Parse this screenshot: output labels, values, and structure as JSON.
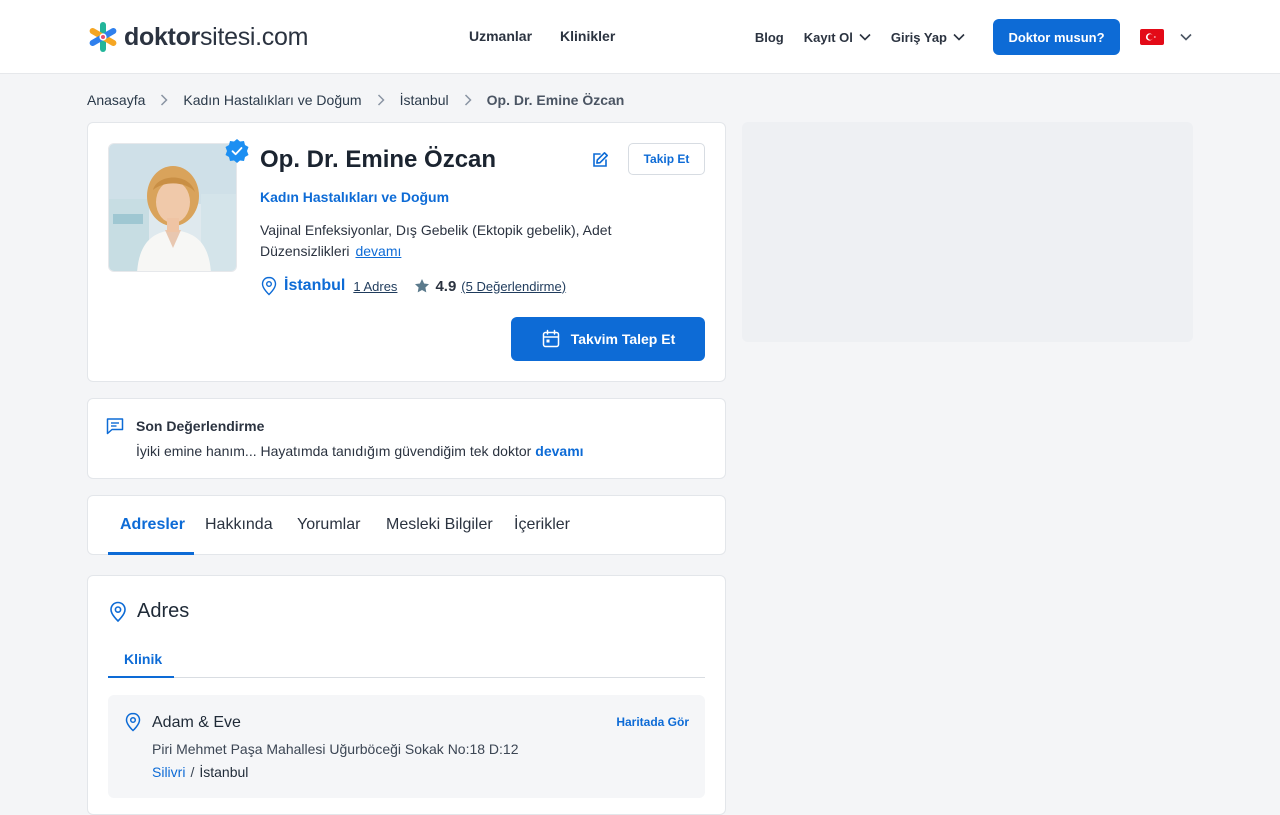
{
  "header": {
    "logo": {
      "bold": "doktor",
      "rest": "sitesi.com"
    },
    "nav": [
      "Uzmanlar",
      "Klinikler"
    ],
    "blog": "Blog",
    "register": "Kayıt Ol",
    "login": "Giriş Yap",
    "doctor_cta": "Doktor musun?",
    "language_flag": "turkey-flag"
  },
  "breadcrumb": [
    "Anasayfa",
    "Kadın Hastalıkları ve Doğum",
    "İstanbul",
    "Op. Dr. Emine Özcan"
  ],
  "profile": {
    "name": "Op. Dr. Emine Özcan",
    "follow_label": "Takip Et",
    "specialty": "Kadın Hastalıkları ve Doğum",
    "conditions": "Vajinal Enfeksiyonlar, Dış Gebelik (Ektopik gebelik), Adet Düzensizlikleri",
    "more_label": "devamı",
    "city": "İstanbul",
    "address_count": "1 Adres",
    "rating": "4.9",
    "rating_count": "(5 Değerlendirme)",
    "calendar_label": "Takvim Talep Et"
  },
  "review": {
    "title": "Son Değerlendirme",
    "text": "İyiki emine hanım... Hayatımda tanıdığım güvendiğim tek doktor",
    "more_label": "devamı"
  },
  "tabs": [
    "Adresler",
    "Hakkında",
    "Yorumlar",
    "Mesleki Bilgiler",
    "İçerikler"
  ],
  "address": {
    "title": "Adres",
    "subtab": "Klinik",
    "clinic_name": "Adam & Eve",
    "map_label": "Haritada Gör",
    "street": "Piri Mehmet Paşa Mahallesi Uğurböceği Sokak No:18 D:12",
    "district": "Silivri",
    "separator": "/",
    "city": "İstanbul"
  },
  "colors": {
    "brand": "#0d6bd6",
    "background": "#f4f5f7",
    "text": "#1f2a37"
  }
}
